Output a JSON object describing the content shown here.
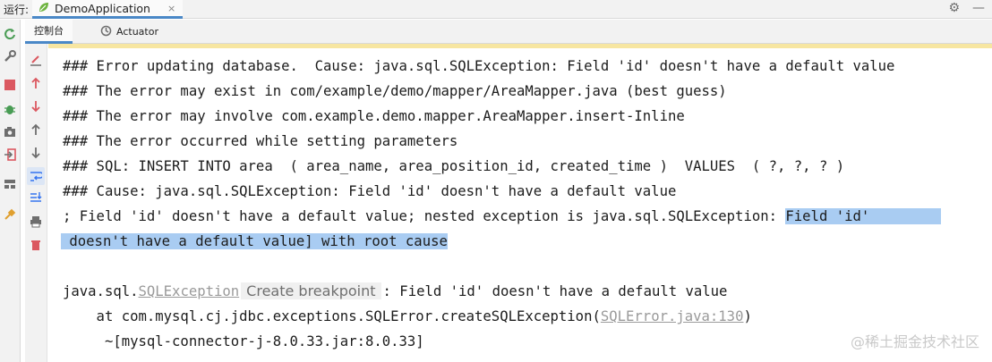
{
  "topbar": {
    "run_label": "运行:",
    "tab_title": "DemoApplication",
    "close_glyph": "×"
  },
  "subtabs": {
    "console": "控制台",
    "actuator": "Actuator"
  },
  "console": {
    "lines": [
      "### Error updating database.  Cause: java.sql.SQLException: Field 'id' doesn't have a default value",
      "### The error may exist in com/example/demo/mapper/AreaMapper.java (best guess)",
      "### The error may involve com.example.demo.mapper.AreaMapper.insert-Inline",
      "### The error occurred while setting parameters",
      "### SQL: INSERT INTO area  ( area_name, area_position_id, created_time )  VALUES  ( ?, ?, ? )",
      "### Cause: java.sql.SQLException: Field 'id' doesn't have a default value"
    ],
    "nested_prefix": "; Field 'id' doesn't have a default value; nested exception is java.sql.SQLException: ",
    "nested_selected": "Field 'id'",
    "wrap_selected": " doesn't have a default value] with root cause",
    "exc_prefix": "java.sql.",
    "exc_link": "SQLException",
    "breakpoint_hint": "Create breakpoint",
    "exc_suffix": ": Field 'id' doesn't have a default value",
    "stack_at": "    at com.mysql.cj.jdbc.exceptions.SQLError.createSQLException(",
    "stack_link": "SQLError.java:130",
    "stack_close": ")",
    "jar_line": "     ~[mysql-connector-j-8.0.33.jar:8.0.33]"
  },
  "watermark": "@稀土掘金技术社区",
  "colors": {
    "selection": "#a9ccf2",
    "accent": "#4a88c7",
    "warning_strip": "#f7e6a1",
    "icon_green": "#499c54",
    "icon_red": "#db5860",
    "icon_blue": "#3574f0"
  }
}
